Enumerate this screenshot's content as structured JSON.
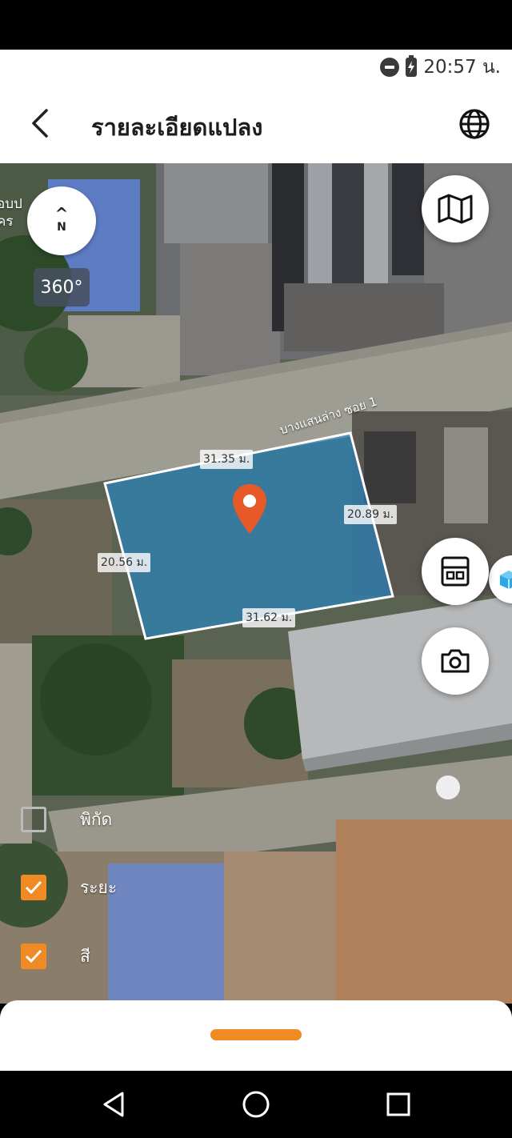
{
  "status_bar": {
    "time": "20:57 น.",
    "icons": [
      "do-not-disturb-icon",
      "battery-charging-icon"
    ]
  },
  "header": {
    "title": "รายละเอียดแปลง",
    "back_icon": "chevron-left-icon",
    "globe_icon": "globe-icon"
  },
  "map": {
    "compass": {
      "arrow": "^",
      "label": "N"
    },
    "view_360_label": "360°",
    "poi_label_partial": "อบป\nคร",
    "road_label": "บางแสนล่าง ซอย 1",
    "parcel": {
      "fill_color": "#1c8ed8",
      "side_labels": {
        "top": "31.35 ม.",
        "right": "20.89 ม.",
        "left": "20.56 ม.",
        "bottom": "31.62 ม."
      }
    },
    "pin_color": "#e8592a",
    "buttons": [
      "map-layers-button",
      "calculator-button",
      "camera-button",
      "3d-view-button"
    ],
    "toggles": [
      {
        "label": "พิกัด",
        "checked": false
      },
      {
        "label": "ระยะ",
        "checked": true
      },
      {
        "label": "สี",
        "checked": true
      }
    ]
  },
  "bottom_sheet": {
    "handle_color": "#f08a24"
  },
  "nav_bar": {
    "buttons": [
      "back-triangle-icon",
      "home-circle-icon",
      "recents-square-icon"
    ]
  }
}
